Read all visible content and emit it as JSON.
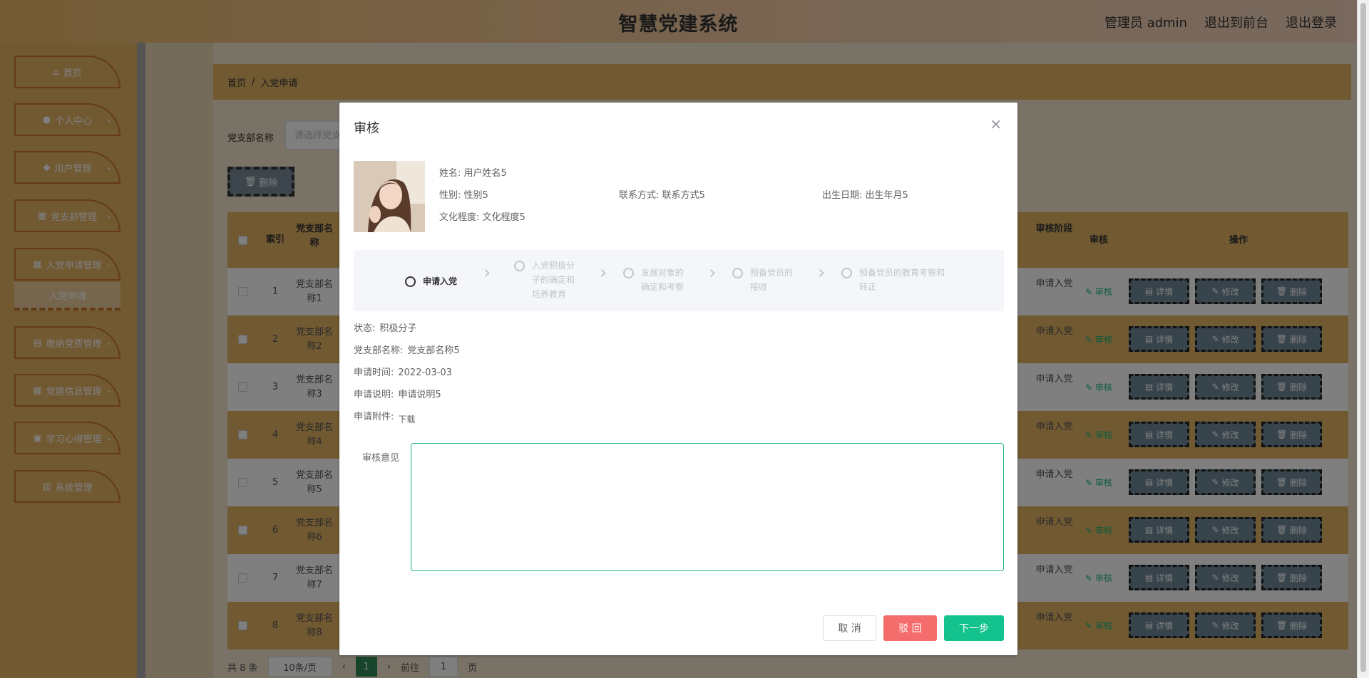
{
  "header": {
    "title": "智慧党建系统",
    "admin": "管理员 admin",
    "front": "退出到前台",
    "logout": "退出登录"
  },
  "sidebar": {
    "items": [
      {
        "label": "首页",
        "icon": "home-icon"
      },
      {
        "label": "个人中心",
        "icon": "user-icon"
      },
      {
        "label": "用户管理",
        "icon": "users-icon"
      },
      {
        "label": "党支部管理",
        "icon": "grid-icon"
      },
      {
        "label": "入党申请管理",
        "icon": "grid-icon"
      },
      {
        "label": "缴纳党费管理",
        "icon": "clipboard-icon"
      },
      {
        "label": "党建信息管理",
        "icon": "grid-icon"
      },
      {
        "label": "学习心得管理",
        "icon": "briefcase-icon"
      },
      {
        "label": "系统管理",
        "icon": "chart-icon"
      }
    ],
    "sub_item": "入党申请"
  },
  "breadcrumb": {
    "home": "首页",
    "sep": "/",
    "current": "入党申请"
  },
  "search": {
    "label": "党支部名称",
    "placeholder": "请选择党支部"
  },
  "toolbar": {
    "delete": "删除"
  },
  "table": {
    "headers": {
      "index": "索引",
      "name": "党支部名称",
      "stage": "审核阶段",
      "audit": "审核",
      "ops": "操作"
    },
    "rows": [
      {
        "index": "1",
        "name": "党支部名称1",
        "stage": "申请入党"
      },
      {
        "index": "2",
        "name": "党支部名称2",
        "stage": "申请入党"
      },
      {
        "index": "3",
        "name": "党支部名称3",
        "stage": "申请入党"
      },
      {
        "index": "4",
        "name": "党支部名称4",
        "stage": "申请入党"
      },
      {
        "index": "5",
        "name": "党支部名称5",
        "stage": "申请入党"
      },
      {
        "index": "6",
        "name": "党支部名称6",
        "stage": "申请入党"
      },
      {
        "index": "7",
        "name": "党支部名称7",
        "stage": "申请入党"
      },
      {
        "index": "8",
        "name": "党支部名称8",
        "stage": "申请入党"
      }
    ],
    "audit_label": "审核",
    "op_detail": "详情",
    "op_edit": "修改",
    "op_delete": "删除"
  },
  "pager": {
    "total": "共 8 条",
    "size": "10条/页",
    "page": "1",
    "goto": "前往",
    "goto_val": "1",
    "page_unit": "页"
  },
  "dialog": {
    "title": "审核",
    "name_label": "姓名:",
    "name": "用户姓名5",
    "gender_label": "性别:",
    "gender": "性别5",
    "contact_label": "联系方式:",
    "contact": "联系方式5",
    "birth_label": "出生日期:",
    "birth": "出生年月5",
    "edu_label": "文化程度:",
    "edu": "文化程度5",
    "steps": [
      {
        "label": "申请入党"
      },
      {
        "label": "入党积极分子的确定和培养教育"
      },
      {
        "label": "发展对象的确定和考察"
      },
      {
        "label": "预备党员的接收"
      },
      {
        "label": "预备党员的教育考察和转正"
      }
    ],
    "status_label": "状态:",
    "status": "积极分子",
    "branch_label": "党支部名称:",
    "branch": "党支部名称5",
    "time_label": "申请时间:",
    "time": "2022-03-03",
    "desc_label": "申请说明:",
    "desc": "申请说明5",
    "attach_label": "申请附件:",
    "attach": "下载",
    "opinion_label": "审核意见",
    "cancel": "取 消",
    "reject": "驳 回",
    "next": "下一步"
  }
}
